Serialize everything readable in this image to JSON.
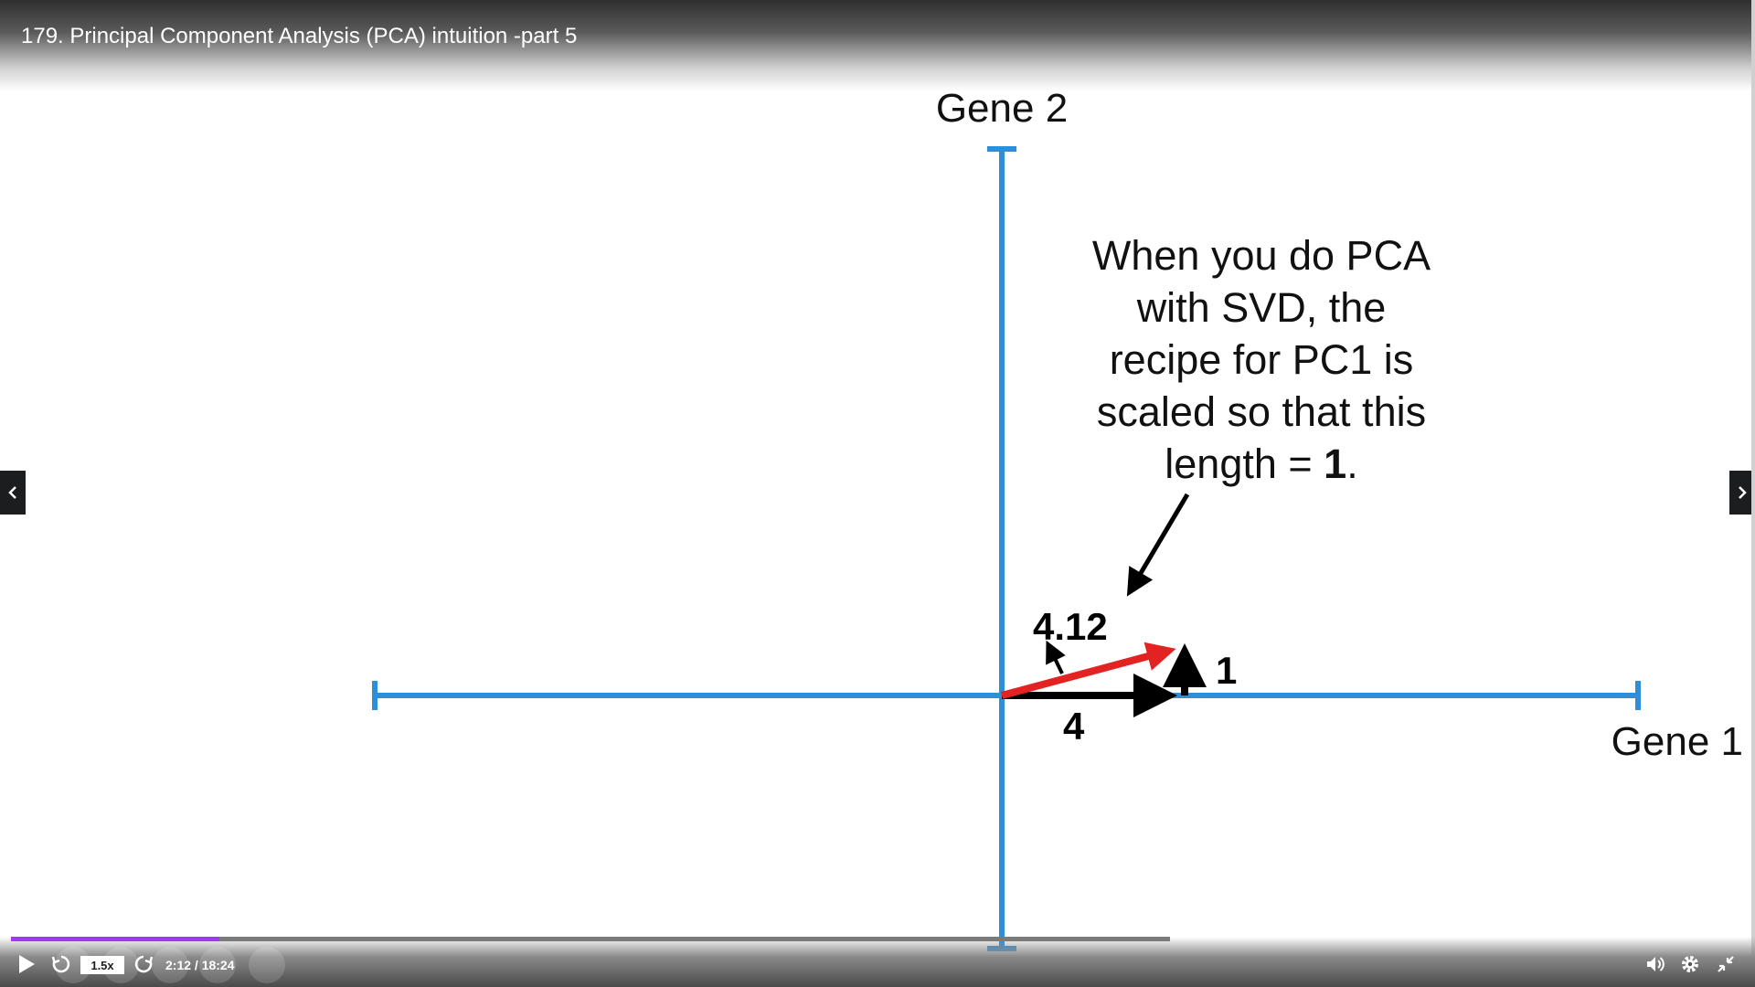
{
  "video": {
    "title": "179. Principal Component Analysis (PCA) intuition -part 5"
  },
  "slide": {
    "y_axis_label": "Gene 2",
    "x_axis_label": "Gene 1",
    "caption_lines": [
      "When you do PCA",
      "with SVD, the",
      "recipe for PC1 is",
      "scaled so that this"
    ],
    "caption_last_prefix": "length = ",
    "caption_last_bold": "1",
    "caption_last_suffix": ".",
    "hypotenuse_label": "4.12",
    "vertical_label": "1",
    "horizontal_label": "4",
    "colors": {
      "axis": "#2e8fd8",
      "pc1_vector": "#e32222",
      "vectors": "#000000"
    }
  },
  "player": {
    "playback_rate": "1.5x",
    "time": "2:12 / 18:24",
    "progress_fraction": 0.18,
    "progress_color": "#a435f0",
    "icons": [
      "play-icon",
      "rewind-icon",
      "forward-icon",
      "volume-icon",
      "settings-icon",
      "exit-fullscreen-icon"
    ]
  }
}
